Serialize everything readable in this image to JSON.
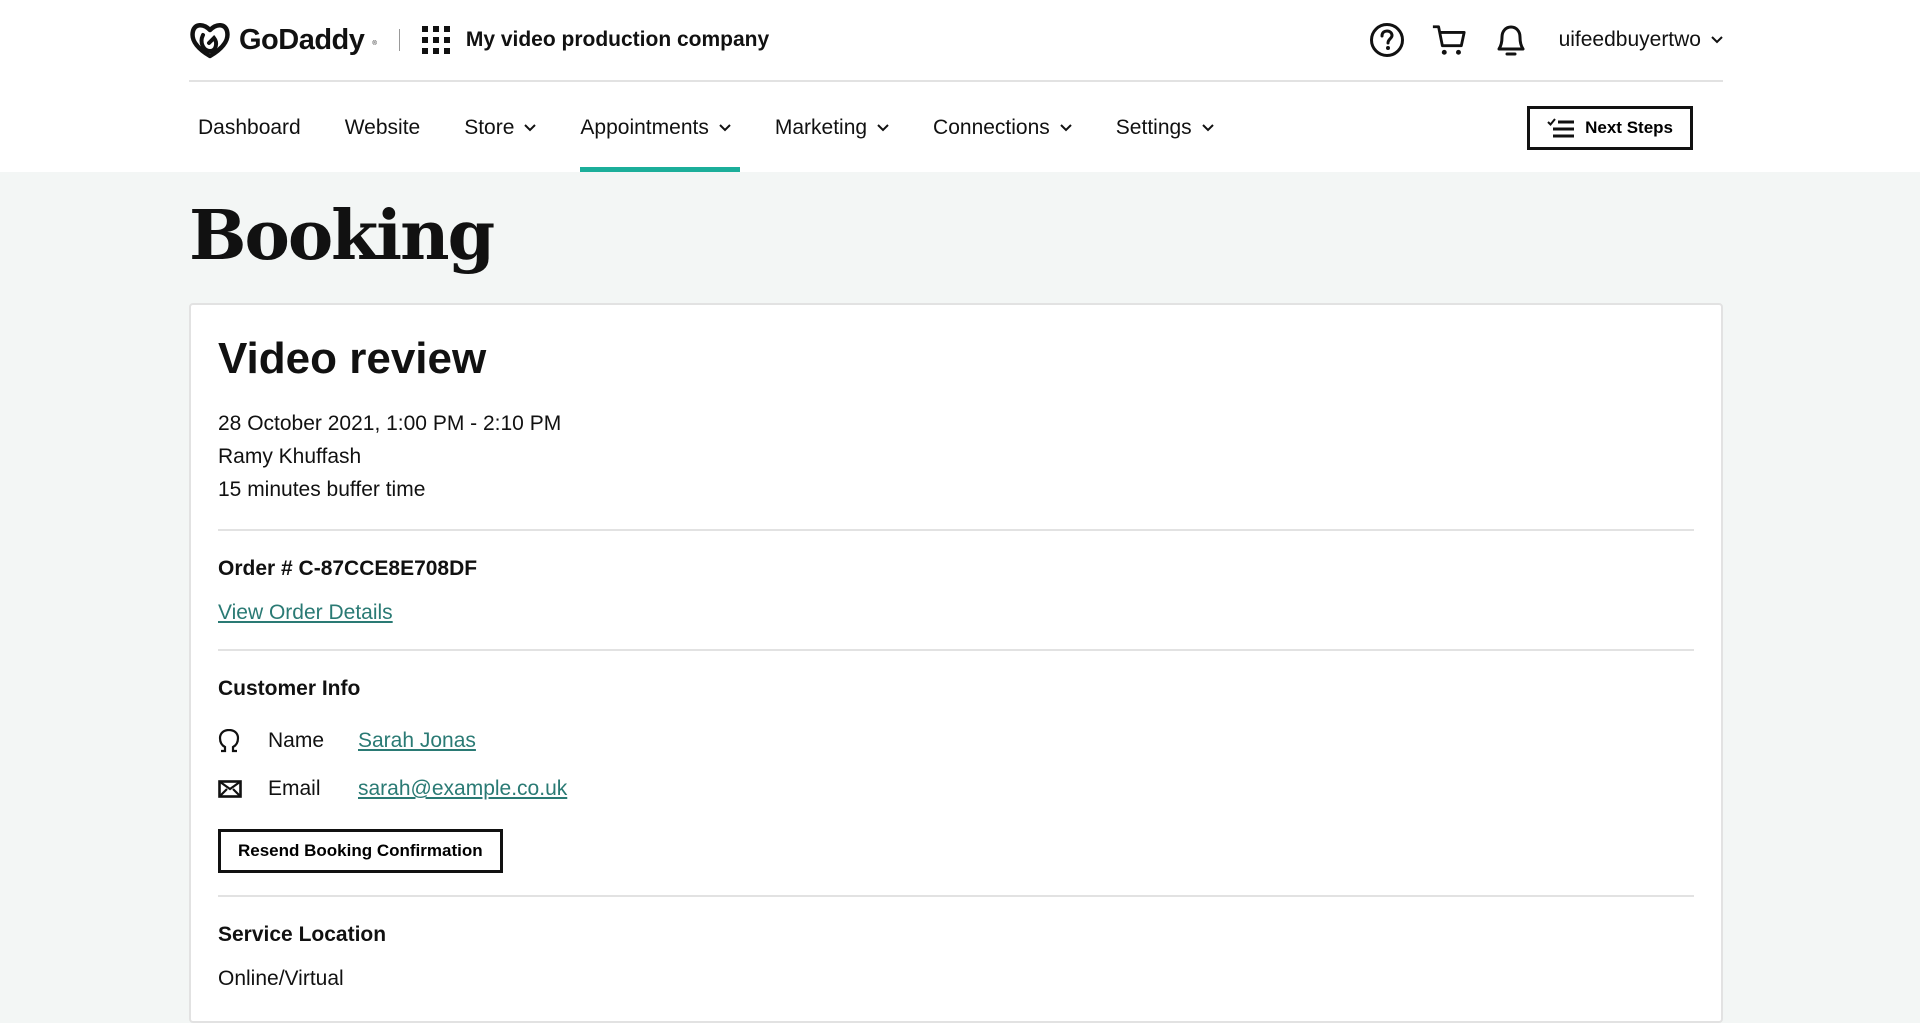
{
  "header": {
    "brand": "GoDaddy",
    "company_name": "My video production company",
    "icons": [
      "help-icon",
      "cart-icon",
      "bell-icon"
    ],
    "username": "uifeedbuyertwo"
  },
  "nav": {
    "items": [
      {
        "label": "Dashboard",
        "has_menu": false,
        "active": false
      },
      {
        "label": "Website",
        "has_menu": false,
        "active": false
      },
      {
        "label": "Store",
        "has_menu": true,
        "active": false
      },
      {
        "label": "Appointments",
        "has_menu": true,
        "active": true
      },
      {
        "label": "Marketing",
        "has_menu": true,
        "active": false
      },
      {
        "label": "Connections",
        "has_menu": true,
        "active": false
      },
      {
        "label": "Settings",
        "has_menu": true,
        "active": false
      }
    ],
    "next_steps_label": "Next Steps"
  },
  "page": {
    "title": "Booking"
  },
  "booking": {
    "service": "Video review",
    "datetime": "28 October 2021, 1:00 PM - 2:10 PM",
    "staff": "Ramy Khuffash",
    "buffer": "15 minutes buffer time",
    "order_number": "Order # C-87CCE8E708DF",
    "view_order_label": "View Order Details",
    "customer_info_title": "Customer Info",
    "customer": {
      "name_label": "Name",
      "name_value": "Sarah Jonas",
      "email_label": "Email",
      "email_value": "sarah@example.co.uk"
    },
    "resend_label": "Resend Booking Confirmation",
    "service_location_title": "Service Location",
    "service_location_value": "Online/Virtual"
  },
  "colors": {
    "accent": "#1bae9a",
    "link": "#2a7a74",
    "page_bg": "#f3f6f5"
  }
}
